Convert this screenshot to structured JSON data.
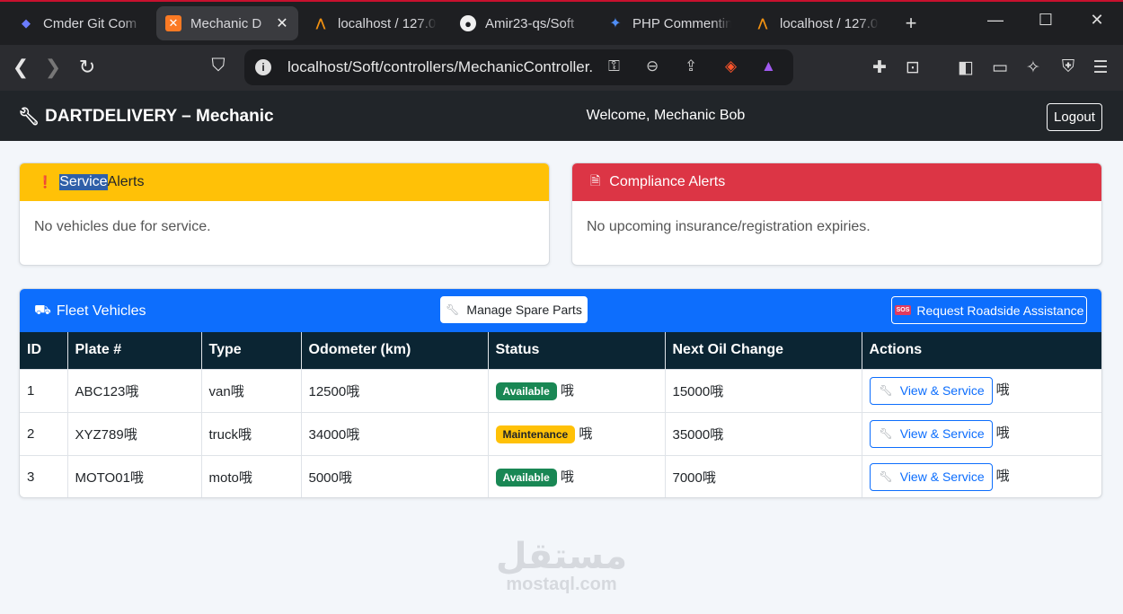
{
  "browser": {
    "tabs": [
      {
        "title": "Cmder Git Com",
        "icon": "cmder-icon",
        "active": false
      },
      {
        "title": "Mechanic D",
        "icon": "xampp-icon",
        "active": true
      },
      {
        "title": "localhost / 127.0",
        "icon": "phpmyadmin-icon",
        "active": false
      },
      {
        "title": "Amir23-qs/Soft",
        "icon": "github-icon",
        "active": false
      },
      {
        "title": "PHP Commenting",
        "icon": "gemini-icon",
        "active": false
      },
      {
        "title": "localhost / 127.0",
        "icon": "phpmyadmin-icon",
        "active": false
      }
    ],
    "url": "localhost/Soft/controllers/MechanicController.php"
  },
  "app": {
    "brand": "DARTDELIVERY – Mechanic",
    "welcome": "Welcome, Mechanic Bob",
    "logout": "Logout"
  },
  "service_alerts": {
    "title_highlighted": "Service",
    "title_rest": " Alerts",
    "message": "No vehicles due for service.",
    "color": "#ffc107"
  },
  "compliance_alerts": {
    "title": "Compliance Alerts",
    "message": "No upcoming insurance/registration expiries.",
    "color": "#dc3545"
  },
  "fleet": {
    "title": "Fleet Vehicles",
    "manage_spare_parts": "Manage Spare Parts",
    "sos_badge": "SOS",
    "request_roadside": "Request Roadside Assistance",
    "columns": [
      "ID",
      "Plate #",
      "Type",
      "Odometer (km)",
      "Status",
      "Next Oil Change",
      "Actions"
    ],
    "rows": [
      {
        "id": "1",
        "plate": "ABC123",
        "type": "van",
        "odometer": "12500",
        "status": "Available",
        "next_oil": "15000",
        "action": "View & Service"
      },
      {
        "id": "2",
        "plate": "XYZ789",
        "type": "truck",
        "odometer": "34000",
        "status": "Maintenance",
        "next_oil": "35000",
        "action": "View & Service"
      },
      {
        "id": "3",
        "plate": "MOTO01",
        "type": "moto",
        "odometer": "5000",
        "status": "Available",
        "next_oil": "7000",
        "action": "View & Service"
      }
    ],
    "trailing_glyph": "哦"
  },
  "watermark": {
    "arabic": "مستقل",
    "latin": "mostaql.com"
  }
}
